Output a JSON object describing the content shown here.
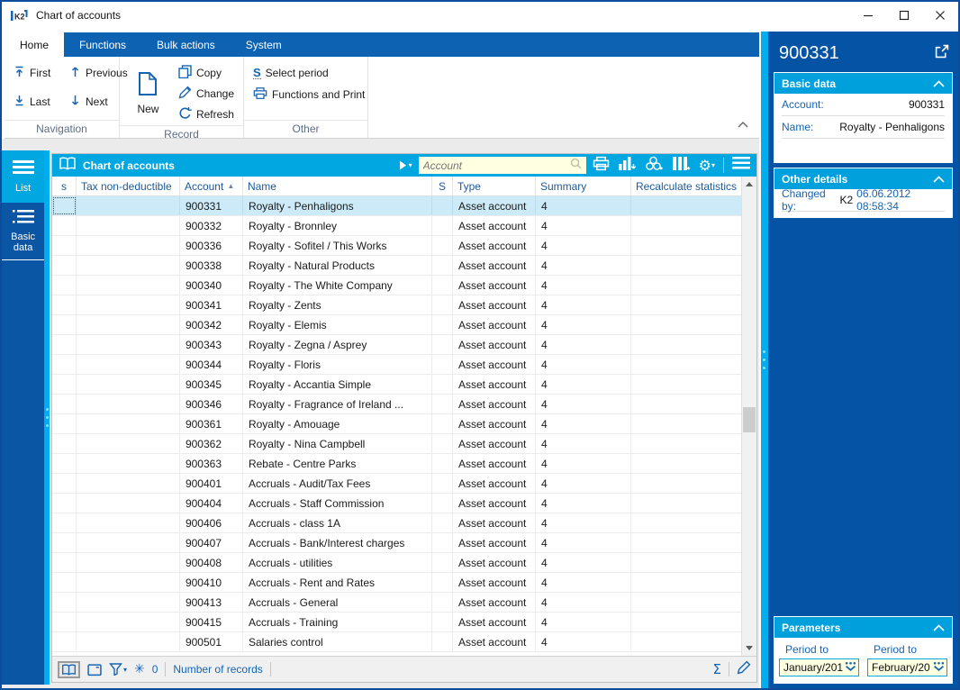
{
  "window": {
    "title": "Chart of accounts",
    "logo_text": "K2"
  },
  "ribbon": {
    "tabs": [
      {
        "label": "Home",
        "active": true
      },
      {
        "label": "Functions",
        "active": false
      },
      {
        "label": "Bulk actions",
        "active": false
      },
      {
        "label": "System",
        "active": false
      }
    ],
    "groups": [
      {
        "label": "Navigation",
        "buttons": {
          "first": "First",
          "previous": "Previous",
          "last": "Last",
          "next": "Next"
        }
      },
      {
        "label": "Record",
        "buttons": {
          "new": "New",
          "copy": "Copy",
          "change": "Change",
          "refresh": "Refresh"
        }
      },
      {
        "label": "Other",
        "buttons": {
          "select_period": "Select period",
          "functions_print": "Functions and Print"
        }
      }
    ]
  },
  "sidebar": {
    "items": [
      {
        "label": "List",
        "active": true
      },
      {
        "label": "Basic data",
        "active": false
      }
    ]
  },
  "table": {
    "title": "Chart of accounts",
    "search_placeholder": "Account",
    "columns": [
      "s",
      "Tax non-deductible",
      "Account",
      "Name",
      "S",
      "Type",
      "Summary",
      "Recalculate statistics"
    ],
    "sort": {
      "column": "Account",
      "direction": "asc"
    },
    "selected_index": 0,
    "rows": [
      {
        "account": "900331",
        "name": "Royalty - Penhaligons",
        "type": "Asset account",
        "summary": "4"
      },
      {
        "account": "900332",
        "name": "Royalty - Bronnley",
        "type": "Asset account",
        "summary": "4"
      },
      {
        "account": "900336",
        "name": "Royalty - Sofitel / This Works",
        "type": "Asset account",
        "summary": "4"
      },
      {
        "account": "900338",
        "name": "Royalty - Natural Products",
        "type": "Asset account",
        "summary": "4"
      },
      {
        "account": "900340",
        "name": "Royalty - The White Company",
        "type": "Asset account",
        "summary": "4"
      },
      {
        "account": "900341",
        "name": "Royalty - Zents",
        "type": "Asset account",
        "summary": "4"
      },
      {
        "account": "900342",
        "name": "Royalty - Elemis",
        "type": "Asset account",
        "summary": "4"
      },
      {
        "account": "900343",
        "name": "Royalty - Zegna / Asprey",
        "type": "Asset account",
        "summary": "4"
      },
      {
        "account": "900344",
        "name": "Royalty - Floris",
        "type": "Asset account",
        "summary": "4"
      },
      {
        "account": "900345",
        "name": "Royalty - Accantia Simple",
        "type": "Asset account",
        "summary": "4"
      },
      {
        "account": "900346",
        "name": "Royalty - Fragrance of Ireland ...",
        "type": "Asset account",
        "summary": "4"
      },
      {
        "account": "900361",
        "name": "Royalty - Amouage",
        "type": "Asset account",
        "summary": "4"
      },
      {
        "account": "900362",
        "name": "Royalty - Nina Campbell",
        "type": "Asset account",
        "summary": "4"
      },
      {
        "account": "900363",
        "name": "Rebate - Centre Parks",
        "type": "Asset account",
        "summary": "4"
      },
      {
        "account": "900401",
        "name": "Accruals - Audit/Tax Fees",
        "type": "Asset account",
        "summary": "4"
      },
      {
        "account": "900404",
        "name": "Accruals - Staff Commission",
        "type": "Asset account",
        "summary": "4"
      },
      {
        "account": "900406",
        "name": "Accruals - class 1A",
        "type": "Asset account",
        "summary": "4"
      },
      {
        "account": "900407",
        "name": "Accruals - Bank/Interest charges",
        "type": "Asset account",
        "summary": "4"
      },
      {
        "account": "900408",
        "name": "Accruals - utilities",
        "type": "Asset account",
        "summary": "4"
      },
      {
        "account": "900410",
        "name": "Accruals - Rent and Rates",
        "type": "Asset account",
        "summary": "4"
      },
      {
        "account": "900413",
        "name": "Accruals - General",
        "type": "Asset account",
        "summary": "4"
      },
      {
        "account": "900415",
        "name": "Accruals - Training",
        "type": "Asset account",
        "summary": "4"
      },
      {
        "account": "900501",
        "name": "Salaries control",
        "type": "Asset account",
        "summary": "4"
      }
    ],
    "status": {
      "freeze_count": "0",
      "records_label": "Number of records"
    }
  },
  "detail": {
    "title": "900331",
    "basic": {
      "header": "Basic data",
      "fields": [
        {
          "label": "Account:",
          "value": "900331"
        },
        {
          "label": "Name:",
          "value": "Royalty - Penhaligons"
        }
      ]
    },
    "other": {
      "header": "Other details",
      "changed_by_label": "Changed by:",
      "changed_by_user": "K2",
      "changed_by_timestamp": "06.06.2012 08:58:34"
    },
    "parameters": {
      "header": "Parameters",
      "fields": [
        {
          "label": "Period to",
          "value": "January/201"
        },
        {
          "label": "Period to",
          "value": "February/20"
        }
      ]
    }
  },
  "icons": {
    "gear": "⚙",
    "freeze_asterisk": "✳",
    "sigma": "Σ",
    "sort_asc": "▲",
    "caret_down": "▾",
    "select_period_s": "S"
  },
  "colors": {
    "brand_blue": "#0a55a4",
    "ribbon_blue": "#0e62b2",
    "accent_cyan": "#00a7e1",
    "splitter_cyan": "#00aeef",
    "icon_blue": "#1464b4",
    "selected_row": "#cdeaf8",
    "field_yellow": "#ffffe1",
    "header_text_blue": "#1d5a9b"
  }
}
